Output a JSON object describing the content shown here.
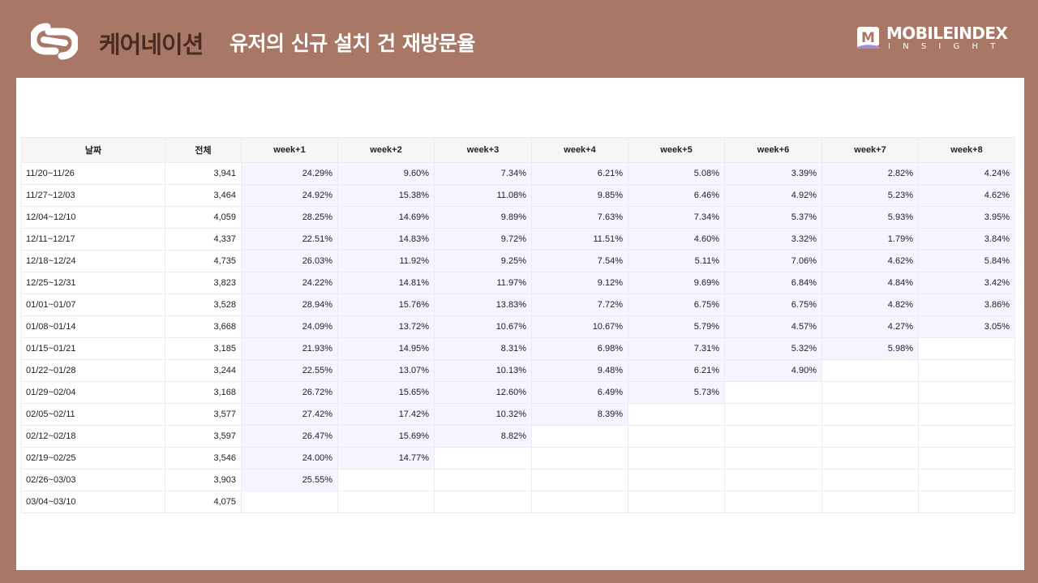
{
  "header": {
    "app_name": "케어네이션",
    "title": "유저의 신규 설치 건 재방문율",
    "brand_name": "MOBILEINDEX",
    "brand_sub": "INSIGHT",
    "brand_badge_letter": "M",
    "logo_icon": "careination-logo-icon",
    "colors": {
      "background": "#a87766",
      "app_name": "#4a2b22",
      "title": "#ffffff",
      "cell_highlight": "#f4f5ff"
    }
  },
  "chart_data": {
    "type": "table",
    "columns": [
      "날짜",
      "전체",
      "week+1",
      "week+2",
      "week+3",
      "week+4",
      "week+5",
      "week+6",
      "week+7",
      "week+8"
    ],
    "rows": [
      {
        "date": "11/20~11/26",
        "total": "3,941",
        "weeks": [
          "24.29%",
          "9.60%",
          "7.34%",
          "6.21%",
          "5.08%",
          "3.39%",
          "2.82%",
          "4.24%"
        ]
      },
      {
        "date": "11/27~12/03",
        "total": "3,464",
        "weeks": [
          "24.92%",
          "15.38%",
          "11.08%",
          "9.85%",
          "6.46%",
          "4.92%",
          "5.23%",
          "4.62%"
        ]
      },
      {
        "date": "12/04~12/10",
        "total": "4,059",
        "weeks": [
          "28.25%",
          "14.69%",
          "9.89%",
          "7.63%",
          "7.34%",
          "5.37%",
          "5.93%",
          "3.95%"
        ]
      },
      {
        "date": "12/11~12/17",
        "total": "4,337",
        "weeks": [
          "22.51%",
          "14.83%",
          "9.72%",
          "11.51%",
          "4.60%",
          "3.32%",
          "1.79%",
          "3.84%"
        ]
      },
      {
        "date": "12/18~12/24",
        "total": "4,735",
        "weeks": [
          "26.03%",
          "11.92%",
          "9.25%",
          "7.54%",
          "5.11%",
          "7.06%",
          "4.62%",
          "5.84%"
        ]
      },
      {
        "date": "12/25~12/31",
        "total": "3,823",
        "weeks": [
          "24.22%",
          "14.81%",
          "11.97%",
          "9.12%",
          "9.69%",
          "6.84%",
          "4.84%",
          "3.42%"
        ]
      },
      {
        "date": "01/01~01/07",
        "total": "3,528",
        "weeks": [
          "28.94%",
          "15.76%",
          "13.83%",
          "7.72%",
          "6.75%",
          "6.75%",
          "4.82%",
          "3.86%"
        ]
      },
      {
        "date": "01/08~01/14",
        "total": "3,668",
        "weeks": [
          "24.09%",
          "13.72%",
          "10.67%",
          "10.67%",
          "5.79%",
          "4.57%",
          "4.27%",
          "3.05%"
        ]
      },
      {
        "date": "01/15~01/21",
        "total": "3,185",
        "weeks": [
          "21.93%",
          "14.95%",
          "8.31%",
          "6.98%",
          "7.31%",
          "5.32%",
          "5.98%"
        ]
      },
      {
        "date": "01/22~01/28",
        "total": "3,244",
        "weeks": [
          "22.55%",
          "13.07%",
          "10.13%",
          "9.48%",
          "6.21%",
          "4.90%"
        ]
      },
      {
        "date": "01/29~02/04",
        "total": "3,168",
        "weeks": [
          "26.72%",
          "15.65%",
          "12.60%",
          "6.49%",
          "5.73%"
        ]
      },
      {
        "date": "02/05~02/11",
        "total": "3,577",
        "weeks": [
          "27.42%",
          "17.42%",
          "10.32%",
          "8.39%"
        ]
      },
      {
        "date": "02/12~02/18",
        "total": "3,597",
        "weeks": [
          "26.47%",
          "15.69%",
          "8.82%"
        ]
      },
      {
        "date": "02/19~02/25",
        "total": "3,546",
        "weeks": [
          "24.00%",
          "14.77%"
        ]
      },
      {
        "date": "02/26~03/03",
        "total": "3,903",
        "weeks": [
          "25.55%"
        ]
      },
      {
        "date": "03/04~03/10",
        "total": "4,075",
        "weeks": []
      }
    ]
  }
}
